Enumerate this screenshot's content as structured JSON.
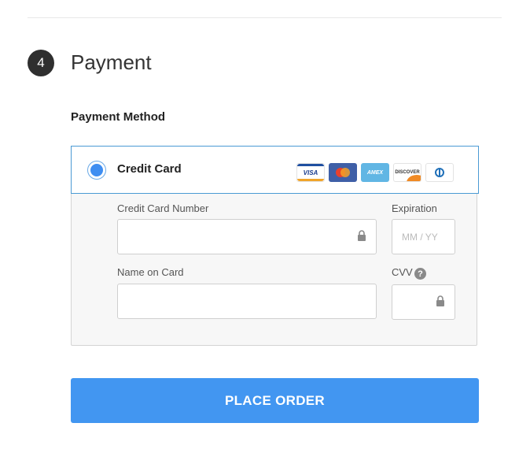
{
  "step": {
    "number": "4",
    "title": "Payment"
  },
  "payment_method": {
    "label": "Payment Method",
    "option_label": "Credit Card",
    "selected": true,
    "logos": [
      {
        "name": "visa",
        "text": "VISA"
      },
      {
        "name": "mastercard",
        "text": ""
      },
      {
        "name": "amex",
        "text": "AMEX"
      },
      {
        "name": "discover",
        "text": "DISCOVER"
      },
      {
        "name": "diners-club",
        "text": ""
      }
    ]
  },
  "fields": {
    "card_number": {
      "label": "Credit Card Number",
      "value": "",
      "placeholder": ""
    },
    "expiration": {
      "label": "Expiration",
      "value": "",
      "placeholder": "MM / YY"
    },
    "name_on_card": {
      "label": "Name on Card",
      "value": "",
      "placeholder": ""
    },
    "cvv": {
      "label": "CVV",
      "value": "",
      "placeholder": "",
      "help_icon": "?"
    }
  },
  "actions": {
    "place_order": "PLACE ORDER"
  },
  "colors": {
    "accent": "#4296f1",
    "selected_border": "#4a9ad4",
    "badge": "#2f2f2f"
  }
}
